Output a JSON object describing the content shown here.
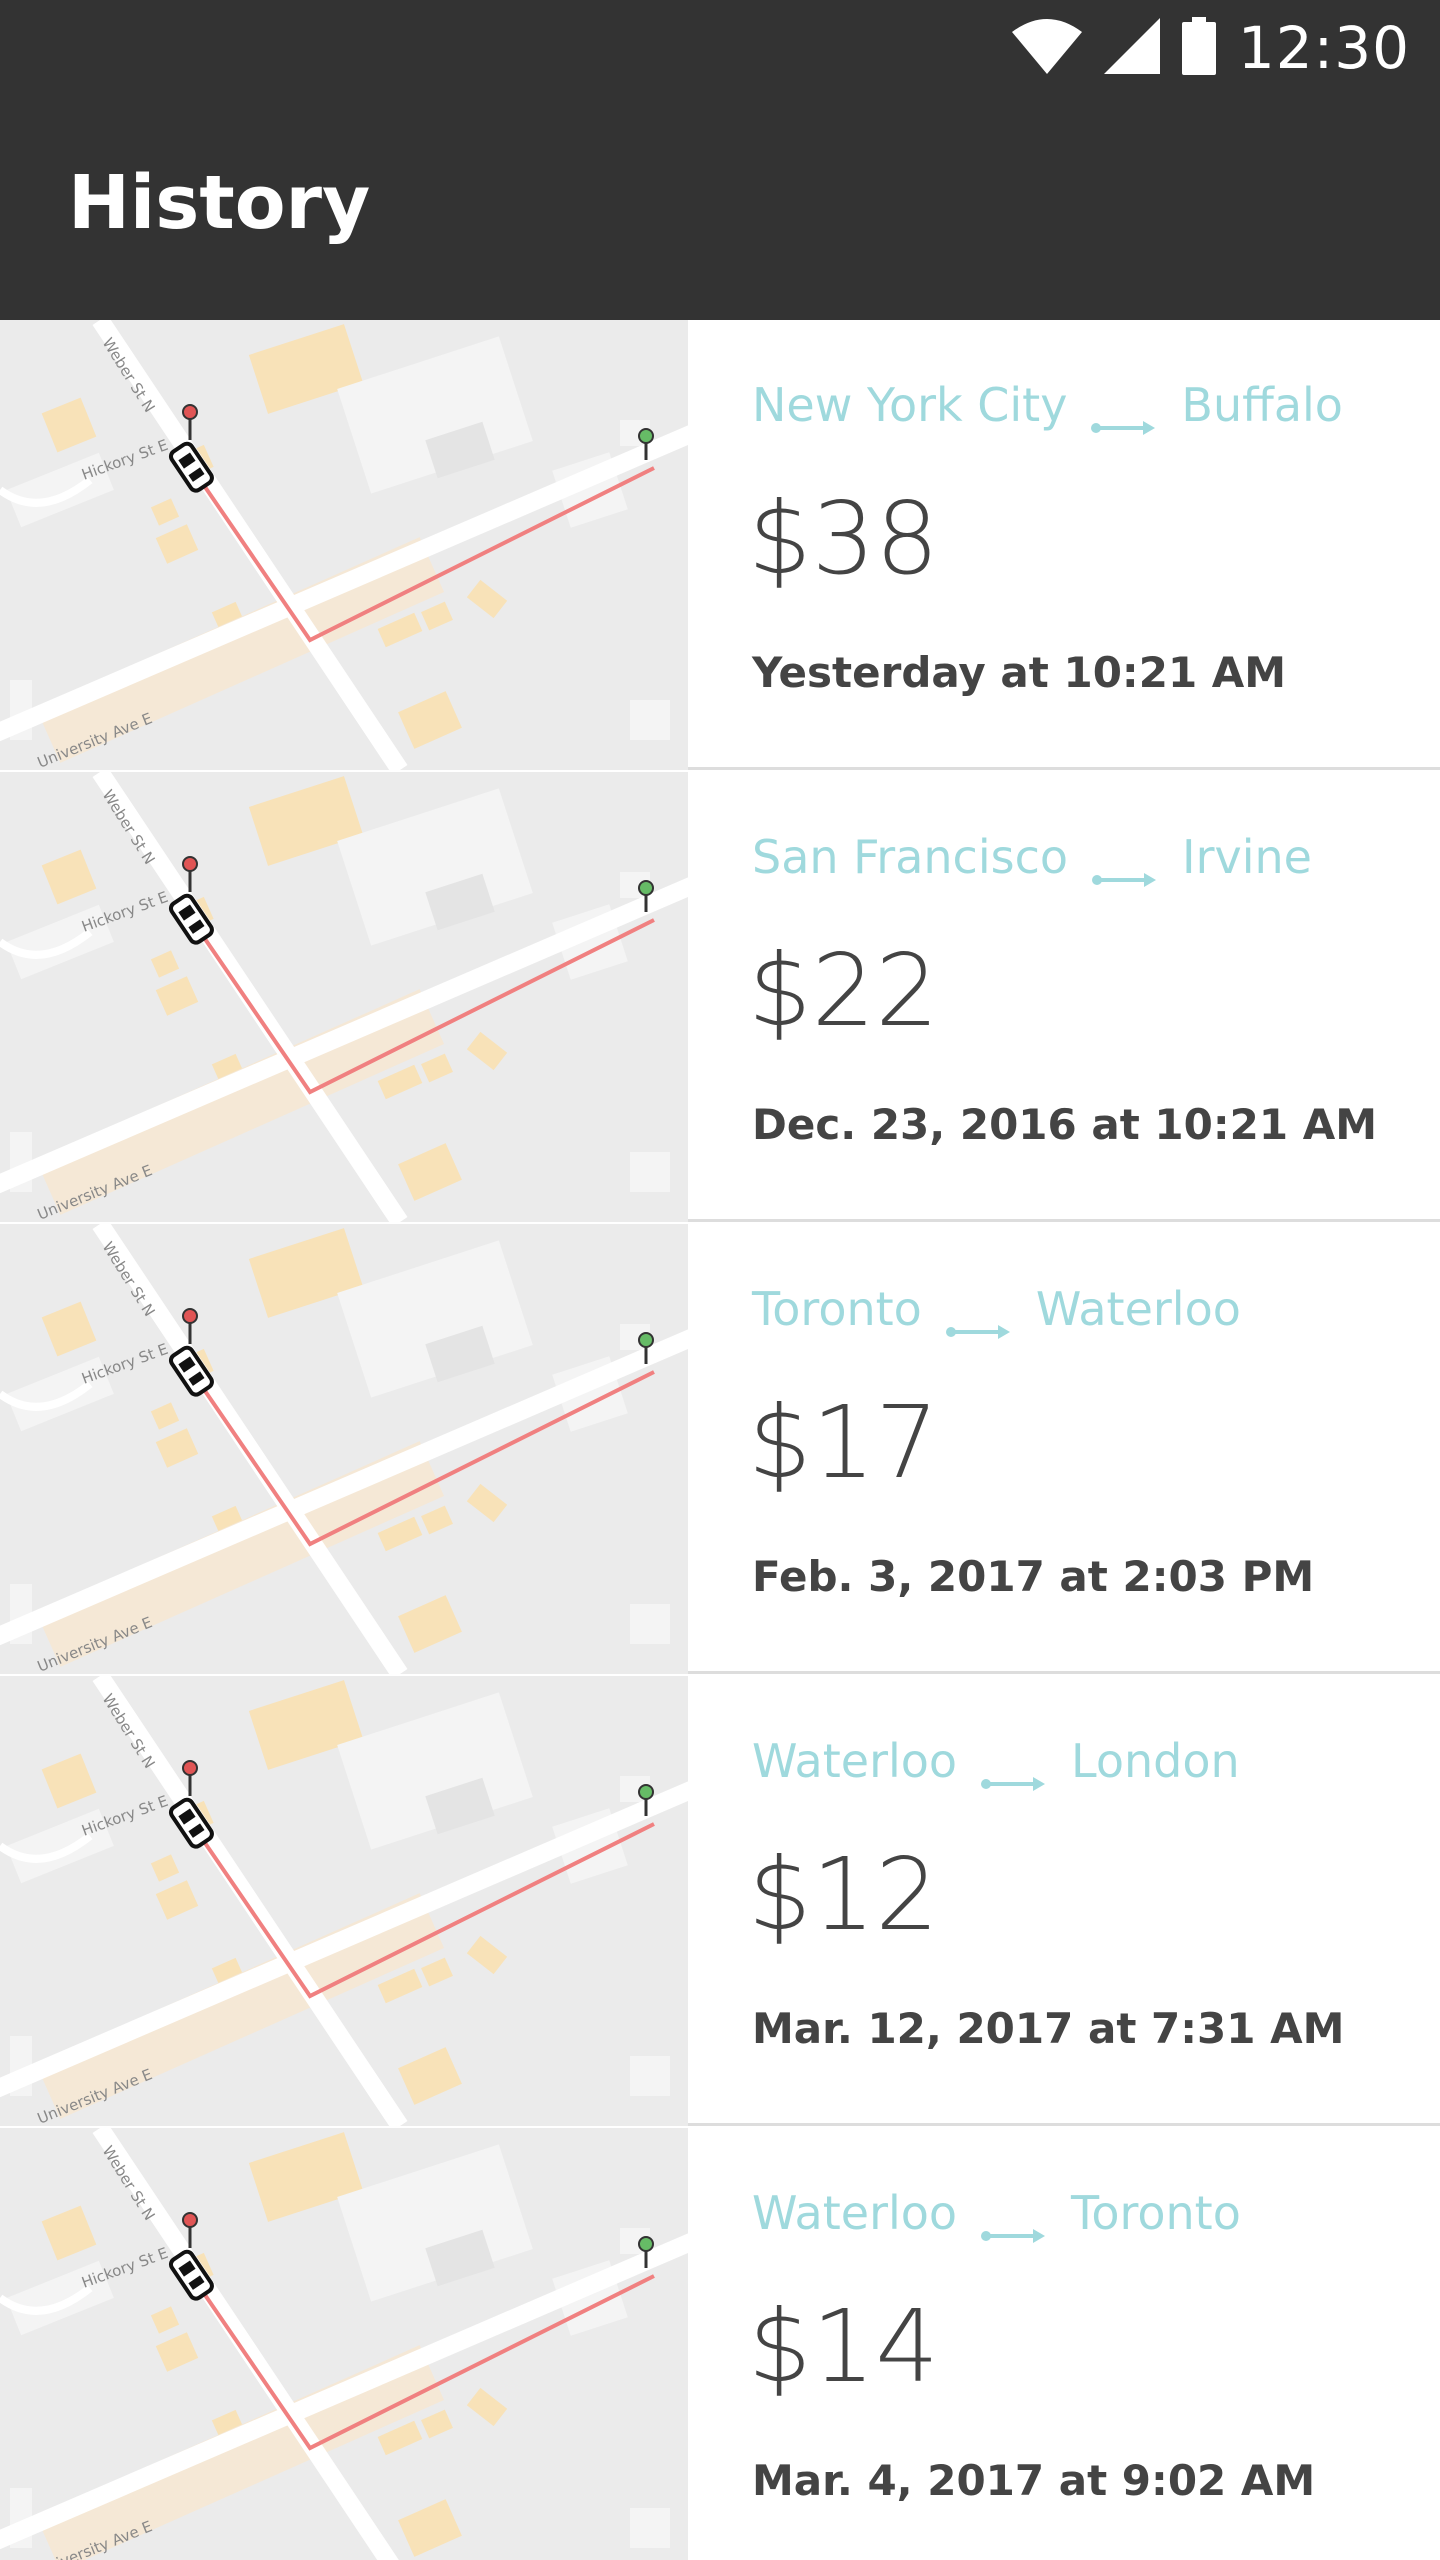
{
  "status_bar": {
    "time": "12:30",
    "icons": [
      "wifi-icon",
      "cellular-signal-icon",
      "battery-icon"
    ],
    "background": "#333333"
  },
  "app_bar": {
    "title": "History",
    "background": "#333333"
  },
  "colors": {
    "route_text": "#9fd9dd",
    "primary_text": "#444444",
    "route_line": "#f08080",
    "map_background": "#ebebeb"
  },
  "map": {
    "street_labels": [
      "Weber St N",
      "Hickory St E",
      "University Ave E"
    ]
  },
  "trips": [
    {
      "from": "New York City",
      "to": "Buffalo",
      "fare": "$38",
      "time": "Yesterday at 10:21 AM"
    },
    {
      "from": "San Francisco",
      "to": "Irvine",
      "fare": "$22",
      "time": "Dec. 23, 2016 at 10:21 AM"
    },
    {
      "from": "Toronto",
      "to": "Waterloo",
      "fare": "$17",
      "time": "Feb. 3, 2017 at 2:03 PM"
    },
    {
      "from": "Waterloo",
      "to": "London",
      "fare": "$12",
      "time": "Mar. 12, 2017 at 7:31 AM"
    },
    {
      "from": "Waterloo",
      "to": "Toronto",
      "fare": "$14",
      "time": "Mar. 4, 2017 at 9:02 AM"
    }
  ]
}
